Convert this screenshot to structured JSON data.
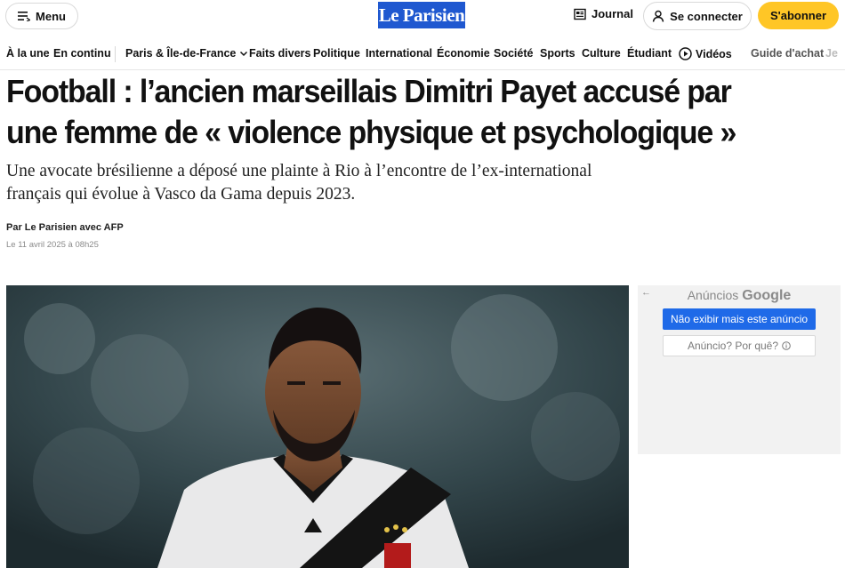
{
  "header": {
    "menu_label": "Menu",
    "logo_text": "Le Parisien",
    "journal_label": "Journal",
    "connect_label": "Se connecter",
    "subscribe_label": "S'abonner"
  },
  "nav": {
    "items": [
      "À la une",
      "En continu",
      "Paris & Île-de-France",
      "Faits divers",
      "Politique",
      "International",
      "Économie",
      "Société",
      "Sports",
      "Culture",
      "Étudiant",
      "Vidéos",
      "Guide d'achat",
      "Je"
    ]
  },
  "article": {
    "title": "Football : l’ancien marseillais Dimitri Payet accusé par une femme de « violence physique et psychologique »",
    "lead": "Une avocate brésilienne a déposé une plainte à Rio à l’encontre de l’ex-international français qui évolue à Vasco da Gama depuis 2023.",
    "byline": "Par Le Parisien avec AFP",
    "date": "Le 11 avril 2025 à 08h25"
  },
  "ad": {
    "header_prefix": "Anúncios",
    "header_brand": "Google",
    "hide_button": "Não exibir mais este anúncio",
    "why_button": "Anúncio? Por quê?"
  },
  "colors": {
    "brand_blue": "#1f58d0",
    "subscribe_yellow": "#ffc626",
    "ad_blue": "#1f6ae8"
  }
}
